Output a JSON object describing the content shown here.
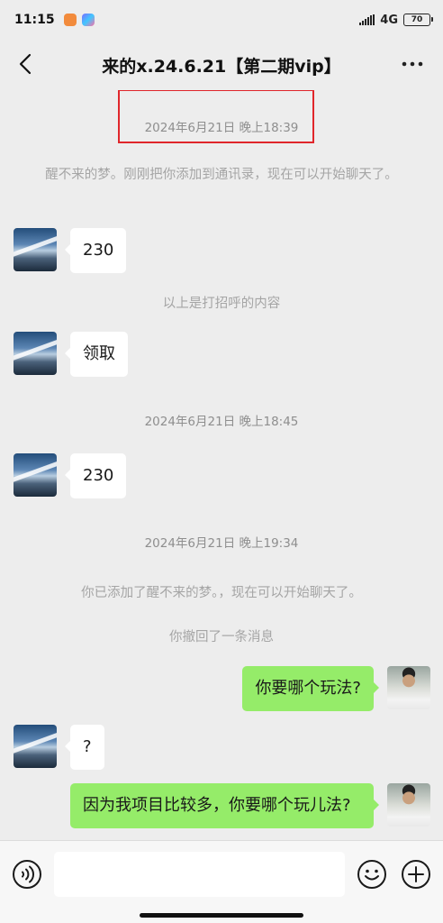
{
  "status_bar": {
    "time": "11:15",
    "network": "4G",
    "battery": "70"
  },
  "header": {
    "title": "来的x.24.6.21【第二期vip】"
  },
  "messages": {
    "ts1": "2024年6月21日 晚上18:39",
    "sys1": "醒不来的梦。刚刚把你添加到通讯录，现在可以开始聊天了。",
    "m1": "230",
    "sys2": "以上是打招呼的内容",
    "m2": "领取",
    "ts2": "2024年6月21日 晚上18:45",
    "m3": "230",
    "ts3": "2024年6月21日 晚上19:34",
    "sys3": "你已添加了醒不来的梦。，现在可以开始聊天了。",
    "sys4": "你撤回了一条消息",
    "m4": "你要哪个玩法?",
    "m5": "?",
    "m6": "因为我项目比较多，你要哪个玩儿法?"
  },
  "input": {
    "value": "",
    "placeholder": ""
  },
  "colors": {
    "outgoing_bubble": "#95ec69",
    "incoming_bubble": "#ffffff",
    "background": "#ededed",
    "highlight_box": "#e0262b"
  },
  "icons": [
    "back-arrow-icon",
    "more-dots-icon",
    "voice-icon",
    "emoji-icon",
    "plus-icon"
  ]
}
